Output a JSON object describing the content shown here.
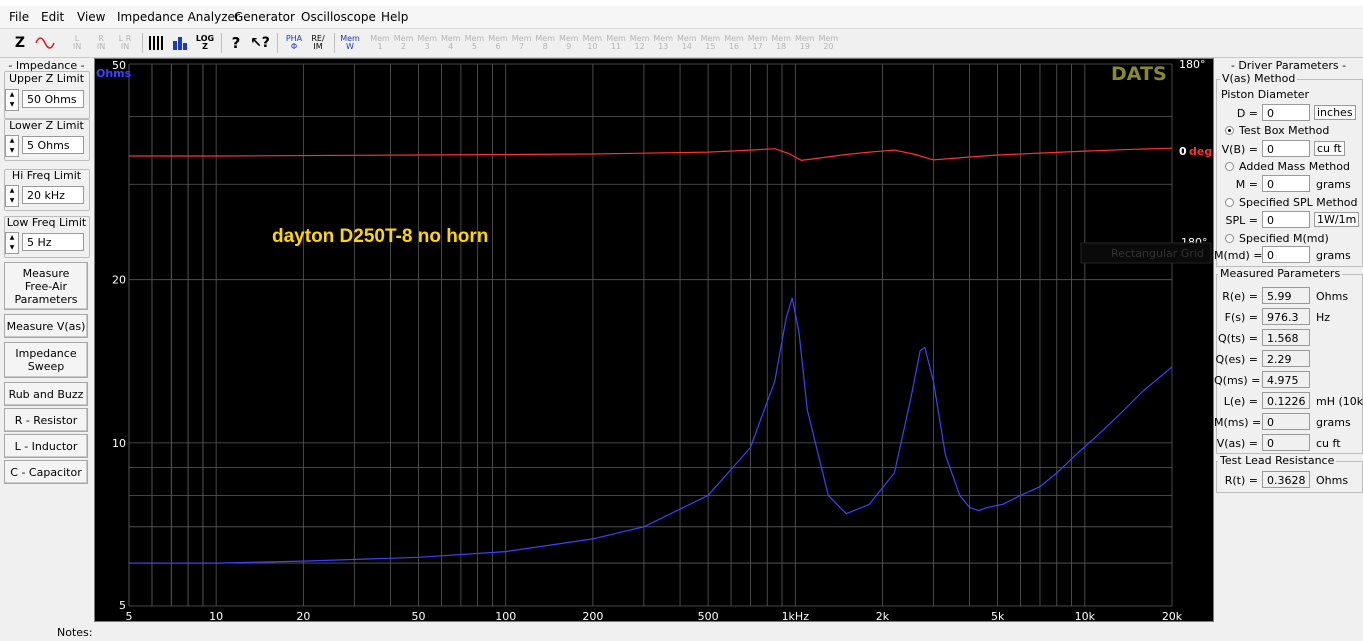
{
  "menu": [
    "File",
    "Edit",
    "View",
    "Impedance Analyzer",
    "Generator",
    "Oscilloscope",
    "Help"
  ],
  "toolbar": {
    "z_icon": "Z",
    "l_in": "L\nIN",
    "r_in": "R\nIN",
    "lr_in": "L R\nIN",
    "log_z": "LOG\nZ",
    "pha": "PHA\nΦ",
    "re_im": "RE/\nIM",
    "mem_w": "Mem\nW",
    "mem_slots": [
      "1",
      "2",
      "3",
      "4",
      "5",
      "6",
      "7",
      "8",
      "9",
      "10",
      "11",
      "12",
      "13",
      "14",
      "15",
      "16",
      "17",
      "18",
      "19",
      "20"
    ],
    "mem_prefix": "Mem"
  },
  "left": {
    "title": "- Impedance -",
    "upper_z": {
      "label": "Upper Z Limit",
      "value": "50 Ohms"
    },
    "lower_z": {
      "label": "Lower Z Limit",
      "value": "5 Ohms"
    },
    "hi_freq": {
      "label": "Hi Freq Limit",
      "value": "20 kHz"
    },
    "low_freq": {
      "label": "Low Freq Limit",
      "value": "5 Hz"
    },
    "buttons": {
      "free_air": "Measure\nFree-Air\nParameters",
      "measure_vas": "Measure V(as)",
      "sweep": "Impedance\nSweep",
      "rub_buzz": "Rub and Buzz",
      "resistor": "R - Resistor",
      "inductor": "L - Inductor",
      "capacitor": "C - Capacitor"
    }
  },
  "chart": {
    "y_unit": "Ohms",
    "brand": "DATS",
    "annotation": "dayton D250T-8 no horn",
    "phase_top": "180°",
    "phase_mid_value": "0",
    "phase_mid_unit": "deg",
    "phase_bottom": "-180°",
    "tooltip": "Rectangular Grid",
    "x_ticks": [
      "5",
      "10",
      "20",
      "50",
      "100",
      "200",
      "500",
      "1kHz",
      "2k",
      "5k",
      "10k",
      "20k"
    ],
    "y_ticks": [
      "50",
      "20",
      "10",
      "5"
    ],
    "colors": {
      "impedance": "#4040ff",
      "phase": "#ff3030",
      "brand": "#8a8a2a",
      "annotation": "#ffd700",
      "grid": "#5a5a5a"
    }
  },
  "chart_data": {
    "type": "line",
    "x_scale": "log",
    "y_scale": "log",
    "xlim": [
      5,
      20000
    ],
    "ylim": [
      5,
      50
    ],
    "y2lim": [
      -180,
      180
    ],
    "grid": true,
    "series": [
      {
        "axis": "impedance",
        "x": [
          5,
          10,
          20,
          50,
          100,
          200,
          300,
          500,
          700,
          850,
          930,
          976,
          1030,
          1100,
          1300,
          1500,
          1800,
          2200,
          2500,
          2700,
          2800,
          3000,
          3300,
          3700,
          4000,
          4300,
          4600,
          5200,
          6000,
          7000,
          8000,
          9500,
          11000,
          13000,
          16000,
          20000
        ],
        "y": [
          6.0,
          6.0,
          6.05,
          6.15,
          6.3,
          6.65,
          7.0,
          8.0,
          9.8,
          13.0,
          17.0,
          18.5,
          16.0,
          11.5,
          8.0,
          7.4,
          7.7,
          8.8,
          12.0,
          14.8,
          15.0,
          13.0,
          9.5,
          8.0,
          7.6,
          7.5,
          7.6,
          7.7,
          8.0,
          8.3,
          8.8,
          9.6,
          10.3,
          11.2,
          12.5,
          13.8
        ]
      },
      {
        "axis": "phase",
        "x": [
          5,
          10,
          50,
          100,
          200,
          500,
          700,
          850,
          950,
          1050,
          1150,
          1500,
          1800,
          2200,
          2600,
          3000,
          3500,
          4000,
          5000,
          7000,
          10000,
          15000,
          20000
        ],
        "y": [
          0,
          0,
          2,
          3,
          4,
          8,
          12,
          15,
          5,
          -9,
          -6,
          3,
          8,
          12,
          3,
          -8,
          -5,
          -2,
          2,
          6,
          10,
          14,
          16
        ]
      }
    ]
  },
  "right": {
    "title": "- Driver Parameters -",
    "vas_method": "V(as) Method",
    "piston": "Piston Diameter",
    "d": {
      "label": "D =",
      "value": "0",
      "unit": "inches"
    },
    "test_box": "Test Box Method",
    "vb": {
      "label": "V(B) =",
      "value": "0",
      "unit": "cu ft"
    },
    "added_mass": "Added Mass Method",
    "m": {
      "label": "M =",
      "value": "0",
      "unit": "grams"
    },
    "spl_method": "Specified SPL Method",
    "spl": {
      "label": "SPL =",
      "value": "0",
      "unit": "1W/1m"
    },
    "mmd_method": "Specified M(md)",
    "mmd": {
      "label": "M(md) =",
      "value": "0",
      "unit": "grams"
    },
    "measured": "Measured Parameters",
    "params": [
      {
        "label": "R(e) =",
        "value": "5.99",
        "unit": "Ohms"
      },
      {
        "label": "F(s) =",
        "value": "976.3",
        "unit": "Hz"
      },
      {
        "label": "Q(ts) =",
        "value": "1.568",
        "unit": ""
      },
      {
        "label": "Q(es) =",
        "value": "2.29",
        "unit": ""
      },
      {
        "label": "Q(ms) =",
        "value": "4.975",
        "unit": ""
      },
      {
        "label": "L(e) =",
        "value": "0.1226",
        "unit": "mH (10k)"
      },
      {
        "label": "M(ms) =",
        "value": "0",
        "unit": "grams"
      },
      {
        "label": "V(as) =",
        "value": "0",
        "unit": "cu ft"
      }
    ],
    "lead": "Test Lead Resistance",
    "rt": {
      "label": "R(t) =",
      "value": "0.3628",
      "unit": "Ohms"
    }
  },
  "notes": "Notes:"
}
